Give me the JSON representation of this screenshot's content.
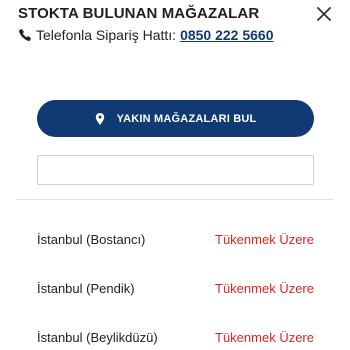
{
  "header": {
    "title": "STOKTA BULUNAN MAĞAZALAR",
    "phone_label": "Telefonla Sipariş Hattı:",
    "phone_number": "0850 222 5660"
  },
  "actions": {
    "find_stores_label": "YAKIN MAĞAZALARI BUL"
  },
  "search": {
    "value": "",
    "placeholder": ""
  },
  "stores": [
    {
      "name": "İstanbul (Bostancı)",
      "status": "Tükenmek Üzere"
    },
    {
      "name": "İstanbul (Pendik)",
      "status": "Tükenmek Üzere"
    },
    {
      "name": "İstanbul (Beylikdüzü)",
      "status": "Tükenmek Üzere"
    }
  ],
  "colors": {
    "brand": "#0f3a73",
    "status_low": "#e02424"
  },
  "icons": {
    "close": "close-icon",
    "phone": "phone-icon",
    "location": "location-pin-icon"
  }
}
